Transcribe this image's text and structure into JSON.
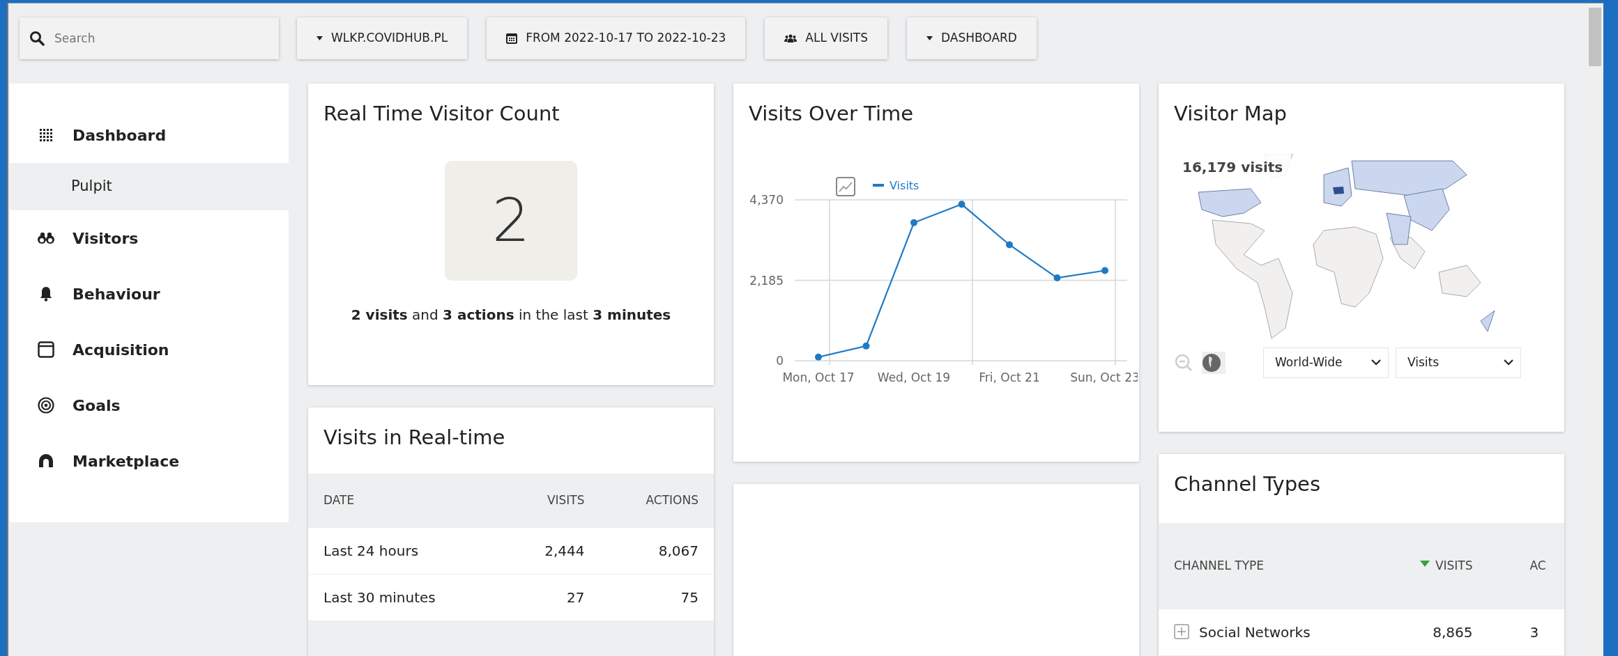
{
  "toolbar": {
    "search": {
      "placeholder": "Search"
    },
    "buttons": [
      {
        "label": "WLKP.COVIDHUB.PL",
        "kind": "dropdown"
      },
      {
        "label": "FROM 2022-10-17 TO 2022-10-23",
        "kind": "calendar"
      },
      {
        "label": "ALL VISITS",
        "kind": "segment"
      },
      {
        "label": "DASHBOARD",
        "kind": "dropdown"
      }
    ]
  },
  "sidebar": {
    "items": [
      {
        "label": "Dashboard",
        "selected": false,
        "children": [
          {
            "label": "Pulpit",
            "selected": true
          }
        ]
      },
      {
        "label": "Visitors",
        "selected": false
      },
      {
        "label": "Behaviour",
        "selected": false
      },
      {
        "label": "Acquisition",
        "selected": false
      },
      {
        "label": "Goals",
        "selected": false
      },
      {
        "label": "Marketplace",
        "selected": false
      }
    ]
  },
  "realtime_count": {
    "title": "Real Time Visitor Count",
    "count": "2",
    "summary": "**2 visits** and **3 actions** in the last **3 minutes**"
  },
  "realtime_table": {
    "title": "Visits in Real-time",
    "columns": [
      "DATE",
      "VISITS",
      "ACTIONS"
    ],
    "rows": [
      [
        "Last 24 hours",
        "2,444",
        "8,067"
      ],
      [
        "Last 30 minutes",
        "27",
        "75"
      ]
    ]
  },
  "visits_over_time": {
    "title": "Visits Over Time",
    "chart_data": {
      "type": "line",
      "categories": [
        "Mon, Oct 17",
        null,
        "Wed, Oct 19",
        null,
        "Fri, Oct 21",
        null,
        "Sun, Oct 23"
      ],
      "series": [
        {
          "name": "Visits",
          "color": "#1f7ac4",
          "marker": true,
          "values": [
            100,
            400,
            3750,
            4250,
            3150,
            2250,
            2450
          ]
        }
      ],
      "ylim": [
        0,
        4370
      ],
      "yticks": [
        {
          "value": 0,
          "label": "0"
        },
        {
          "value": 2185,
          "label": "2,185"
        },
        {
          "value": 4370,
          "label": "4,370"
        }
      ]
    }
  },
  "visitor_map": {
    "title": "Visitor Map",
    "tooltip": "16,179 visits",
    "selects": [
      {
        "value": "World-Wide"
      },
      {
        "value": "Visits"
      }
    ]
  },
  "channel_types": {
    "title": "Channel Types",
    "columns": [
      {
        "label": "CHANNEL TYPE",
        "sorted": false
      },
      {
        "label": "VISITS",
        "sorted": true
      },
      {
        "label": "AC",
        "sorted": false
      }
    ],
    "rows": [
      {
        "cells": [
          "Social Networks",
          "8,865",
          "3"
        ],
        "expanded": false
      }
    ]
  }
}
